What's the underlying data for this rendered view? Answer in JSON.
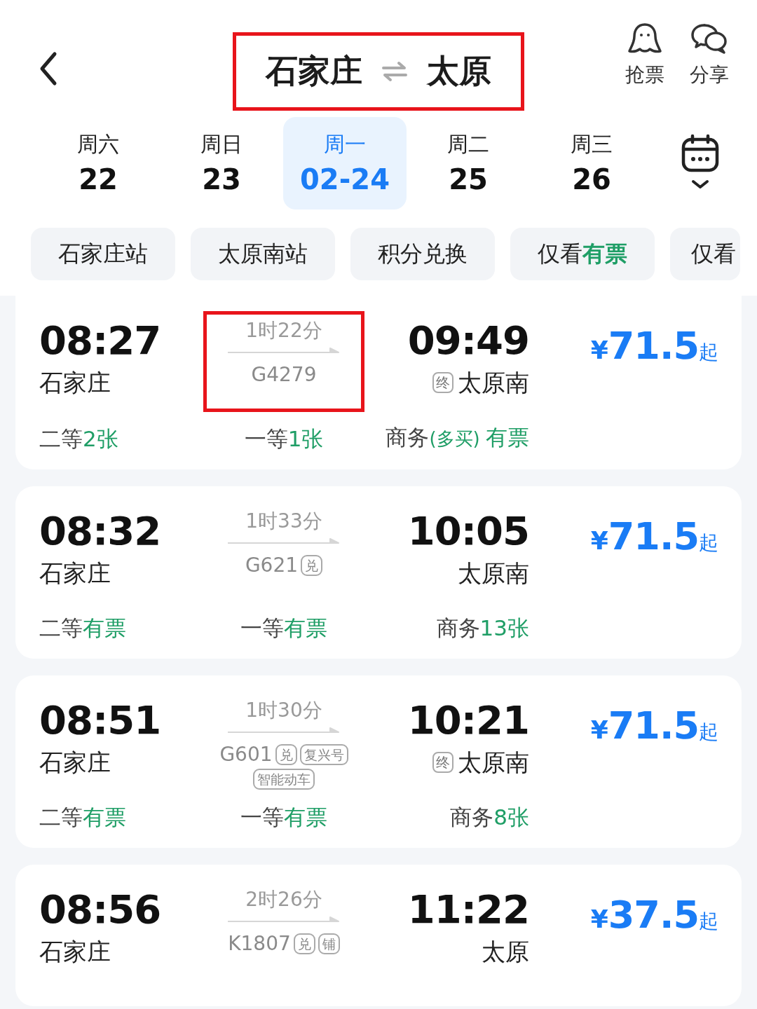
{
  "header": {
    "from": "石家庄",
    "to": "太原",
    "highlighted": true,
    "actions": [
      {
        "kind": "grab",
        "label": "抢票"
      },
      {
        "kind": "share",
        "label": "分享"
      }
    ]
  },
  "dates": [
    {
      "weekday": "周六",
      "date": "22",
      "selected": false
    },
    {
      "weekday": "周日",
      "date": "23",
      "selected": false
    },
    {
      "weekday": "周一",
      "date": "02-24",
      "selected": true
    },
    {
      "weekday": "周二",
      "date": "25",
      "selected": false
    },
    {
      "weekday": "周三",
      "date": "26",
      "selected": false
    }
  ],
  "filters": [
    {
      "label": "石家庄站"
    },
    {
      "label": "太原南站"
    },
    {
      "label": "积分兑换"
    },
    {
      "label": "仅看",
      "accent": "有票"
    },
    {
      "label": "仅看"
    }
  ],
  "trains": [
    {
      "depart": "08:27",
      "from": "石家庄",
      "duration": "1时22分",
      "number": "G4279",
      "arrive": "09:49",
      "terminal": "终",
      "to": "太原南",
      "price": "71.5",
      "currency": "¥",
      "suffix": "起",
      "highlighted": true,
      "seats": [
        {
          "cls": "二等",
          "avail": "2张"
        },
        {
          "cls": "一等",
          "avail": "1张"
        },
        {
          "cls": "商务",
          "note": "(多买)",
          "avail": "有票"
        }
      ]
    },
    {
      "depart": "08:32",
      "from": "石家庄",
      "duration": "1时33分",
      "number": "G621",
      "tags": [
        "兑"
      ],
      "arrive": "10:05",
      "to": "太原南",
      "price": "71.5",
      "currency": "¥",
      "suffix": "起",
      "highlighted": false,
      "seats": [
        {
          "cls": "二等",
          "avail": "有票"
        },
        {
          "cls": "一等",
          "avail": "有票"
        },
        {
          "cls": "商务",
          "avail": "13张"
        }
      ]
    },
    {
      "depart": "08:51",
      "from": "石家庄",
      "duration": "1时30分",
      "number": "G601",
      "tags": [
        "兑",
        "复兴号",
        "智能动车"
      ],
      "arrive": "10:21",
      "terminal": "终",
      "to": "太原南",
      "price": "71.5",
      "currency": "¥",
      "suffix": "起",
      "highlighted": false,
      "seats": [
        {
          "cls": "二等",
          "avail": "有票"
        },
        {
          "cls": "一等",
          "avail": "有票"
        },
        {
          "cls": "商务",
          "avail": "8张"
        }
      ]
    },
    {
      "depart": "08:56",
      "from": "石家庄",
      "duration": "2时26分",
      "number": "K1807",
      "tags": [
        "兑",
        "铺"
      ],
      "arrive": "11:22",
      "to": "太原",
      "price": "37.5",
      "currency": "¥",
      "suffix": "起",
      "highlighted": false
    }
  ]
}
